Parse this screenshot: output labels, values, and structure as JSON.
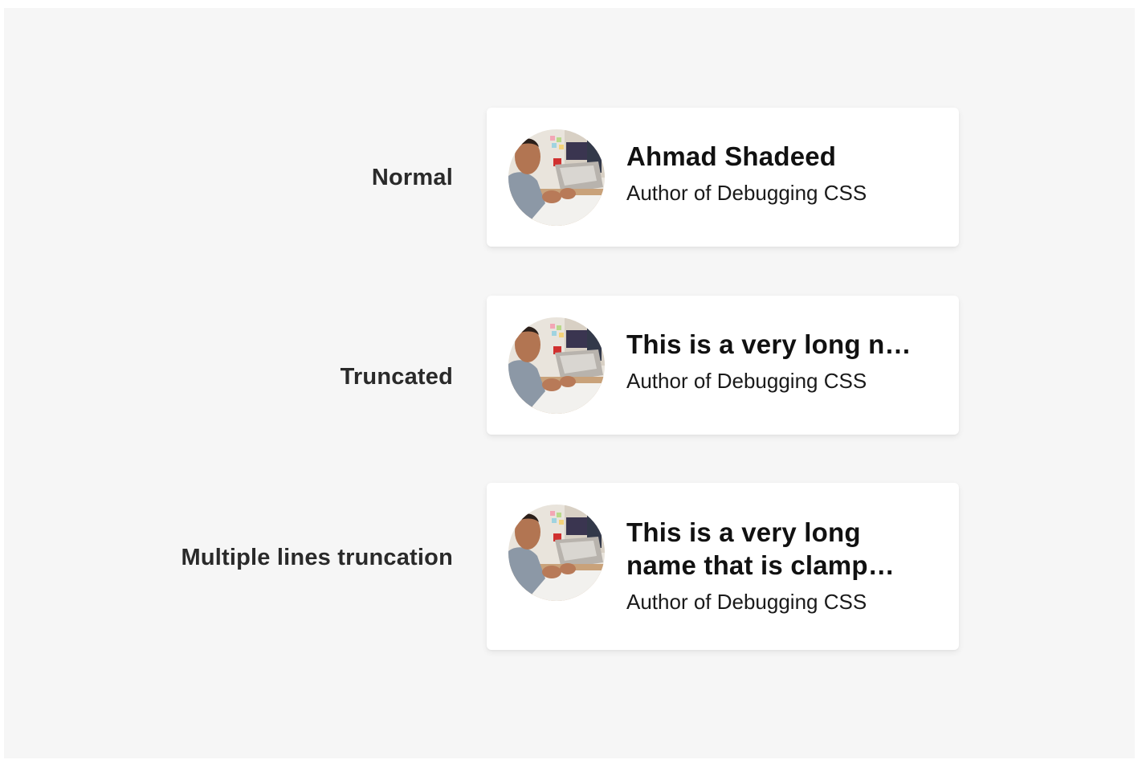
{
  "rows": [
    {
      "label": "Normal",
      "name": "Ahmad Shadeed",
      "role": "Author of Debugging CSS"
    },
    {
      "label": "Truncated",
      "name": "This is a very long name that is truncated",
      "role": "Author of Debugging CSS"
    },
    {
      "label": "Multiple lines truncation",
      "name": "This is a very long name that is clamped to two lines",
      "role": "Author of Debugging CSS"
    }
  ],
  "avatar": {
    "icon": "person-photo-avatar"
  },
  "colors": {
    "background": "#f6f6f6",
    "card": "#ffffff",
    "label_text": "#2a2a2a",
    "name_text": "#111111"
  }
}
